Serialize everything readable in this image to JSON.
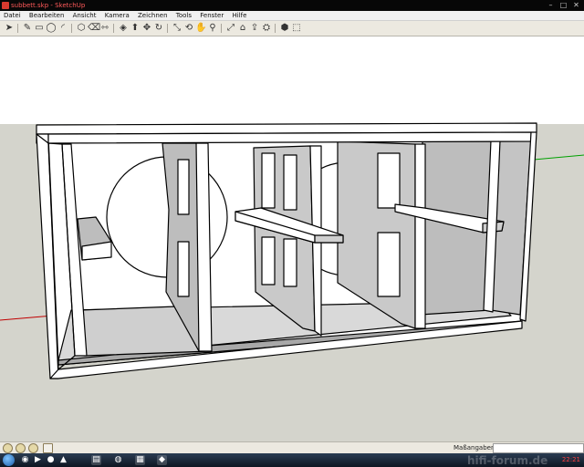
{
  "window": {
    "title": "subbett.skp - SketchUp"
  },
  "menu": [
    "Datei",
    "Bearbeiten",
    "Ansicht",
    "Kamera",
    "Zeichnen",
    "Tools",
    "Fenster",
    "Hilfe"
  ],
  "toolbar": {
    "tools": [
      {
        "name": "select-tool-icon",
        "glyph": "➤"
      },
      {
        "name": "pencil-tool-icon",
        "glyph": "✎"
      },
      {
        "name": "rectangle-tool-icon",
        "glyph": "▭"
      },
      {
        "name": "circle-tool-icon",
        "glyph": "◯"
      },
      {
        "name": "arc-tool-icon",
        "glyph": "◜"
      },
      {
        "name": "make-component-icon",
        "glyph": "⬡"
      },
      {
        "name": "eraser-tool-icon",
        "glyph": "⌫"
      },
      {
        "name": "tape-measure-tool-icon",
        "glyph": "⇿"
      },
      {
        "name": "paint-bucket-icon",
        "glyph": "◈"
      },
      {
        "name": "push-pull-tool-icon",
        "glyph": "⬆"
      },
      {
        "name": "move-tool-icon",
        "glyph": "✥"
      },
      {
        "name": "rotate-tool-icon",
        "glyph": "↻"
      },
      {
        "name": "offset-tool-icon",
        "glyph": "⤡"
      },
      {
        "name": "orbit-tool-icon",
        "glyph": "⟲"
      },
      {
        "name": "pan-tool-icon",
        "glyph": "✋"
      },
      {
        "name": "zoom-tool-icon",
        "glyph": "⚲"
      },
      {
        "name": "zoom-extents-icon",
        "glyph": "⤢"
      },
      {
        "name": "3d-warehouse-icon",
        "glyph": "⌂"
      },
      {
        "name": "share-model-icon",
        "glyph": "⇪"
      },
      {
        "name": "get-models-icon",
        "glyph": "⛭"
      },
      {
        "name": "materials-icon",
        "glyph": "⬢"
      },
      {
        "name": "components-icon",
        "glyph": "⬚"
      }
    ]
  },
  "status": {
    "measure_label": "Maßangaben",
    "value": ""
  },
  "taskbar": {
    "clock": "22:21"
  },
  "watermark": "hifi-forum.de",
  "colors": {
    "background_sky": "#ffffff",
    "ground": "#d4d4cc",
    "face": "#ffffff",
    "shade": "#bdbdbd",
    "axis_red": "#c00000",
    "axis_green": "#00a000"
  }
}
